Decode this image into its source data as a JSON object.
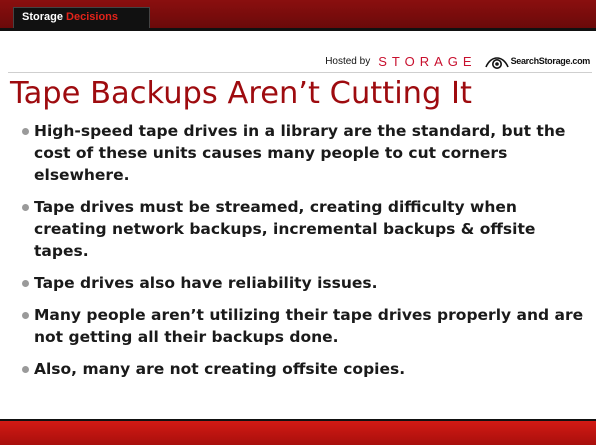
{
  "header": {
    "brand_part1": "Storage",
    "brand_part2": "Decisions",
    "hosted_by": "Hosted by",
    "storage_logo": "STORAGE",
    "searchstorage_logo": "SearchStorage.com"
  },
  "slide": {
    "title": "Tape Backups Aren’t Cutting It",
    "bullets": [
      "High-speed tape drives in a library are the standard, but the cost of these units causes many people to cut corners elsewhere.",
      "Tape drives must be streamed, creating difficulty when creating network backups, incremental backups & offsite tapes.",
      "Tape drives also have reliability issues.",
      "Many people aren’t utilizing their tape drives properly and are not getting all their backups done.",
      "Also, many are not creating offsite copies."
    ]
  },
  "colors": {
    "top_band": "#7a0c0c",
    "brand_accent": "#e2231a",
    "title": "#9e0b0f",
    "bottom_band": "#c01510",
    "bullet_dot": "#9a9a9a"
  }
}
